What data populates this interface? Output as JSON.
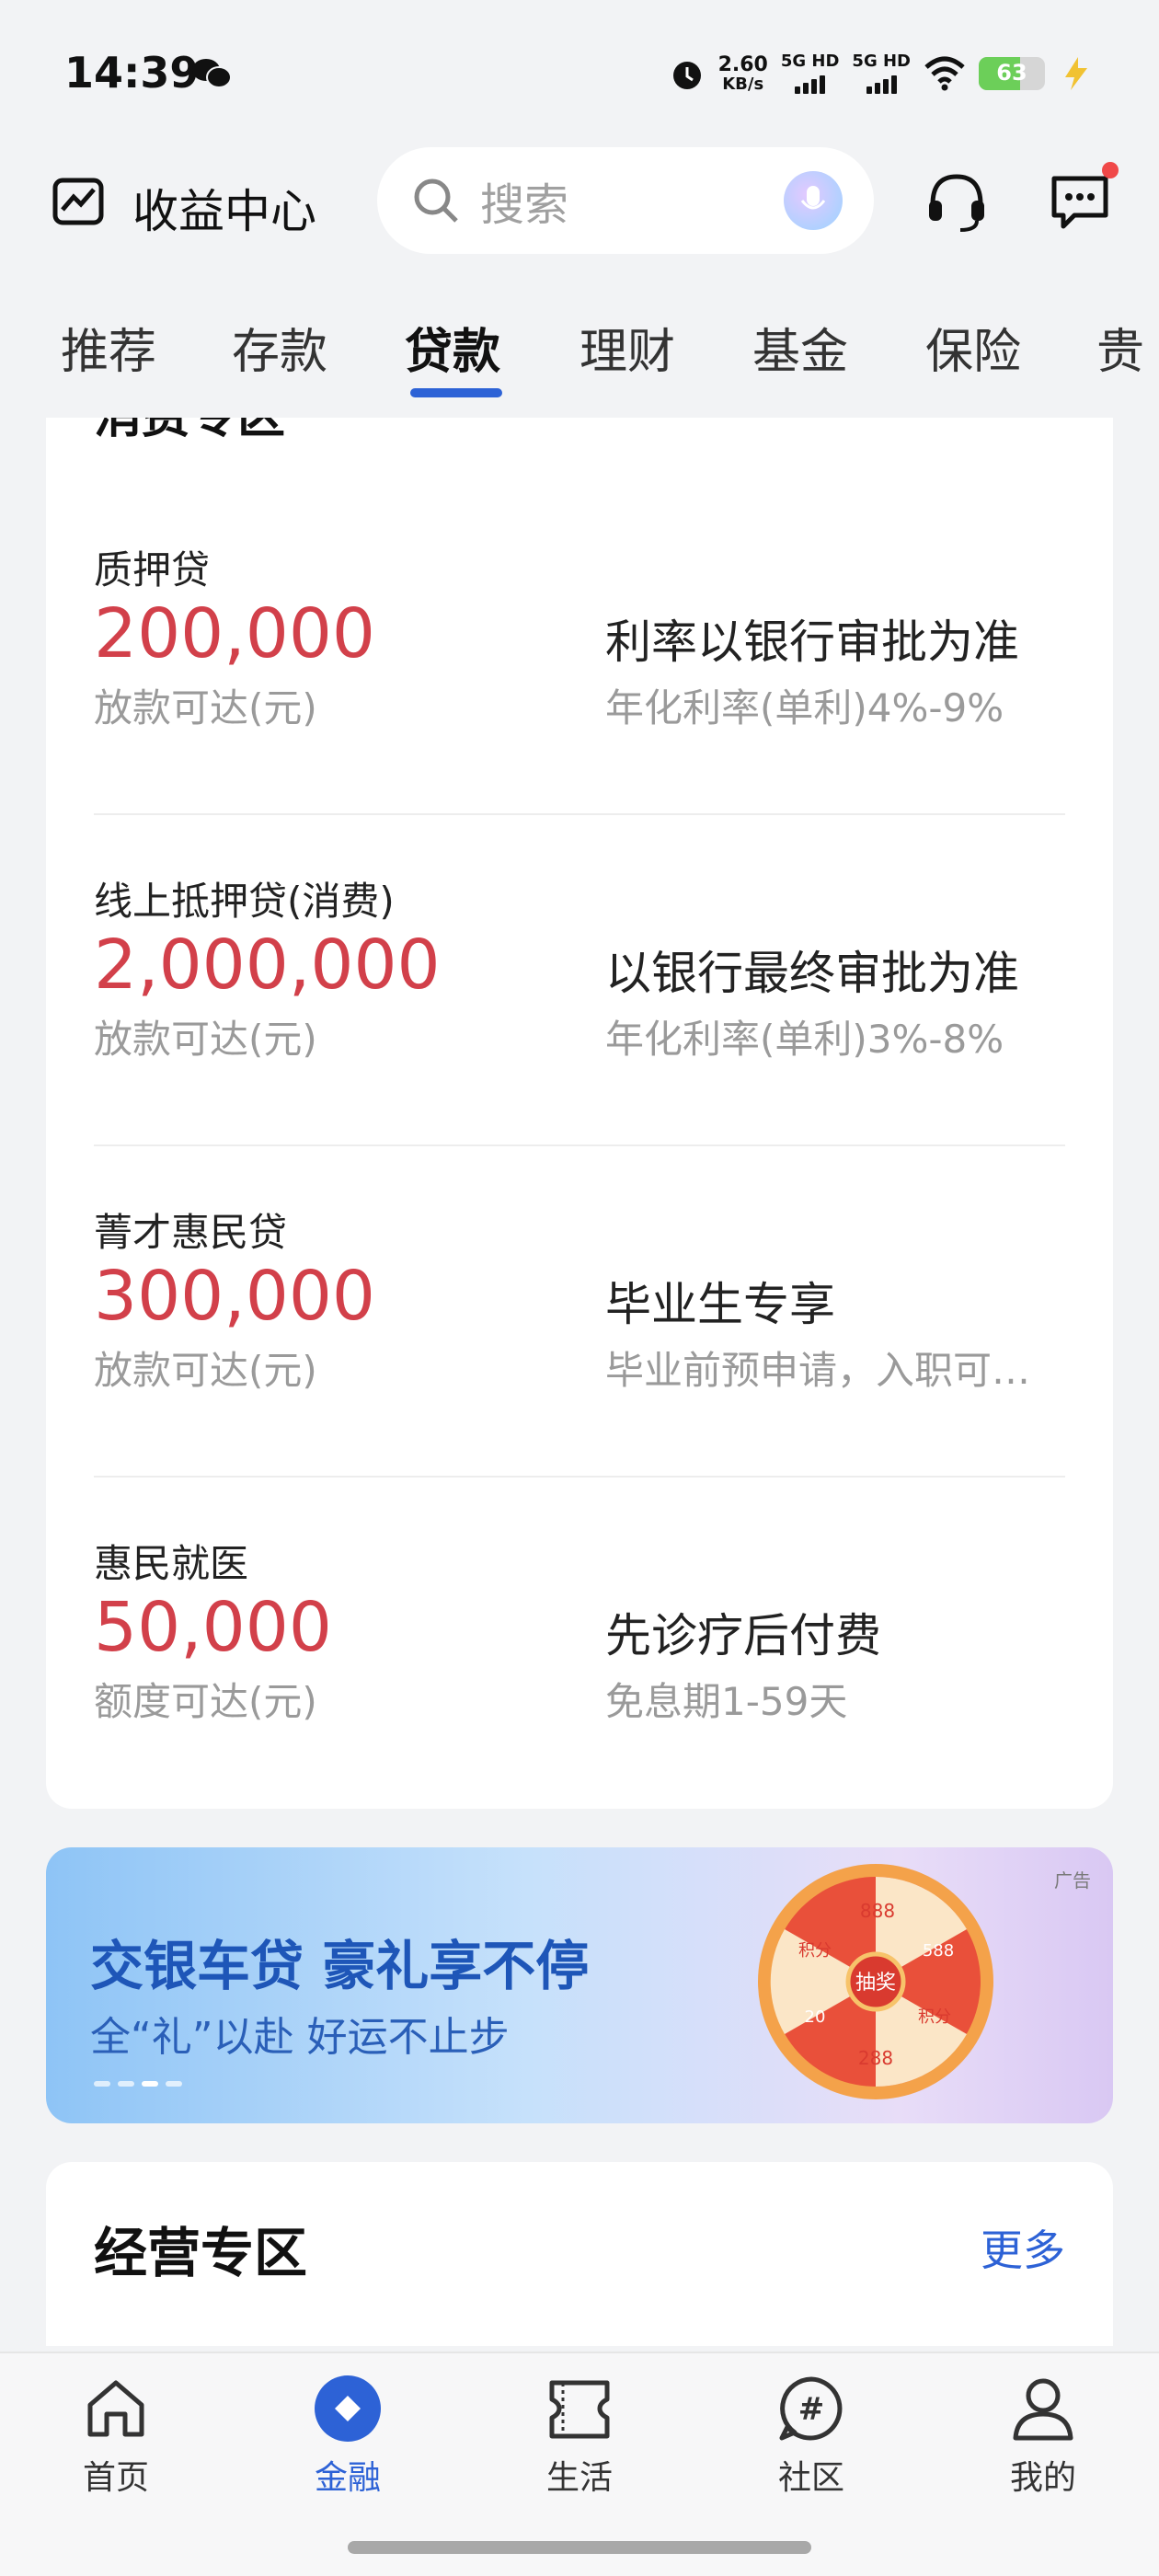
{
  "status_bar": {
    "time": "14:39",
    "net_speed_value": "2.60",
    "net_speed_unit": "KB/s",
    "sim1": "5G HD",
    "sim2": "5G HD",
    "battery": "63",
    "icons": [
      "wechat-icon",
      "alarm-icon",
      "signal-icon",
      "wifi-icon",
      "battery-icon",
      "charging-icon"
    ]
  },
  "header": {
    "title": "收益中心",
    "search_placeholder": "搜索",
    "icons": [
      "trend-chart-icon",
      "search-icon",
      "voice-assistant-icon",
      "customer-service-icon",
      "message-icon"
    ]
  },
  "tabs": [
    "推荐",
    "存款",
    "贷款",
    "理财",
    "基金",
    "保险",
    "贵"
  ],
  "active_tab": "贷款",
  "section_peek": "消费专区",
  "loans": [
    {
      "name": "质押贷",
      "amount": "200,000",
      "amount_label": "放款可达(元)",
      "title": "利率以银行审批为准",
      "sub": "年化利率(单利)4%-9%"
    },
    {
      "name": "线上抵押贷(消费)",
      "amount": "2,000,000",
      "amount_label": "放款可达(元)",
      "title": "以银行最终审批为准",
      "sub": "年化利率(单利)3%-8%"
    },
    {
      "name": "菁才惠民贷",
      "amount": "300,000",
      "amount_label": "放款可达(元)",
      "title": "毕业生专享",
      "sub": "毕业前预申请，入职可…"
    },
    {
      "name": "惠民就医",
      "amount": "50,000",
      "amount_label": "额度可达(元)",
      "title": "先诊疗后付费",
      "sub": "免息期1-59天"
    }
  ],
  "banner": {
    "title": "交银车贷 豪礼享不停",
    "subtitle": "全“礼”以赴 好运不止步",
    "ad_tag": "广告",
    "wheel_center": "抽奖",
    "wheel_labels": [
      "积分",
      "888",
      "588",
      "积分",
      "288",
      "20"
    ]
  },
  "section2": {
    "title": "经营专区",
    "more": "更多"
  },
  "bottom_nav": [
    {
      "label": "首页",
      "icon": "home-icon"
    },
    {
      "label": "金融",
      "icon": "finance-icon"
    },
    {
      "label": "生活",
      "icon": "life-ticket-icon"
    },
    {
      "label": "社区",
      "icon": "community-icon"
    },
    {
      "label": "我的",
      "icon": "profile-icon"
    }
  ],
  "colors": {
    "accent": "#2d62d6",
    "amount": "#d2404a",
    "background": "#f2f3f5"
  }
}
